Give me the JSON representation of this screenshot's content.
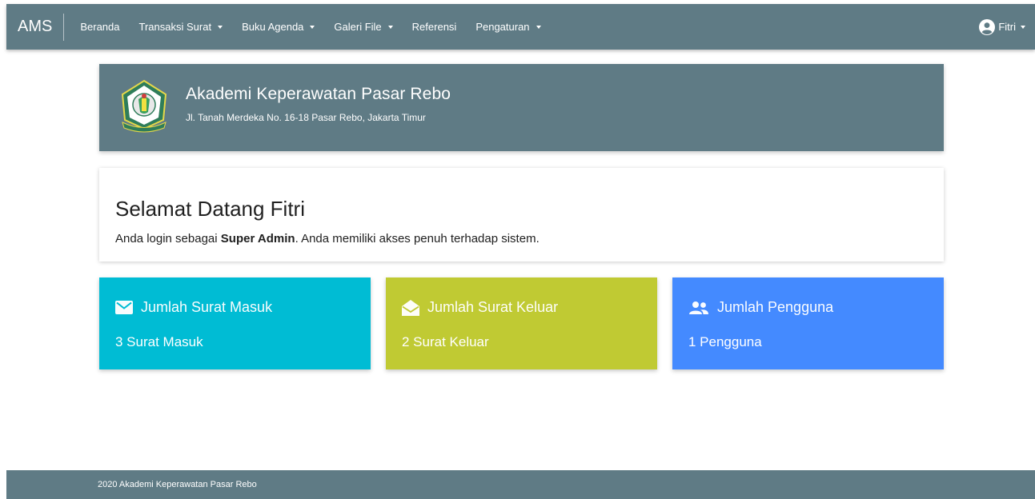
{
  "navbar": {
    "brand": "AMS",
    "items": [
      {
        "label": "Beranda",
        "dropdown": false
      },
      {
        "label": "Transaksi Surat",
        "dropdown": true
      },
      {
        "label": "Buku Agenda",
        "dropdown": true
      },
      {
        "label": "Galeri File",
        "dropdown": true
      },
      {
        "label": "Referensi",
        "dropdown": false
      },
      {
        "label": "Pengaturan",
        "dropdown": true
      }
    ],
    "user": {
      "name": "Fitri",
      "icon": "user-circle-icon"
    }
  },
  "header": {
    "logo_icon": "institution-logo-icon",
    "institution_name": "Akademi Keperawatan Pasar Rebo",
    "address": "Jl. Tanah Merdeka No. 16-18 Pasar Rebo, Jakarta Timur"
  },
  "welcome": {
    "title": "Selamat Datang Fitri",
    "text_prefix": "Anda login sebagai ",
    "role": "Super Admin",
    "text_suffix": ". Anda memiliki akses penuh terhadap sistem."
  },
  "stats": [
    {
      "icon": "envelope-icon",
      "title": "Jumlah Surat Masuk",
      "value": "3 Surat Masuk",
      "color": "#00bcd4"
    },
    {
      "icon": "envelope-open-icon",
      "title": "Jumlah Surat Keluar",
      "value": "2 Surat Keluar",
      "color": "#c0ca33"
    },
    {
      "icon": "users-icon",
      "title": "Jumlah Pengguna",
      "value": "1 Pengguna",
      "color": "#448aff"
    }
  ],
  "footer": {
    "text": "2020 Akademi Keperawatan Pasar Rebo"
  },
  "colors": {
    "primary": "#5f7b85",
    "background": "#ffffff"
  }
}
